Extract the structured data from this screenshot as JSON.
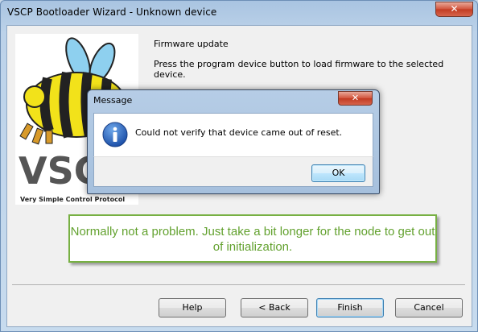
{
  "window": {
    "title": "VSCP  Bootloader Wizard - Unknown device"
  },
  "logo": {
    "text": "VSCP",
    "tagline": "Very Simple Control Protocol"
  },
  "page": {
    "heading": "Firmware update",
    "description": "Press the program device button to load firmware to the selected device."
  },
  "dialog": {
    "title": "Message",
    "message": "Could not verify that device came out of reset.",
    "ok_label": "OK",
    "icon": "info-icon"
  },
  "annotation": {
    "text": "Normally not a problem. Just take a bit longer for the node to get out of initialization."
  },
  "buttons": {
    "help": "Help",
    "back": "< Back",
    "finish": "Finish",
    "cancel": "Cancel"
  },
  "colors": {
    "annotation_green": "#62a12e",
    "annotation_border": "#77b043"
  }
}
